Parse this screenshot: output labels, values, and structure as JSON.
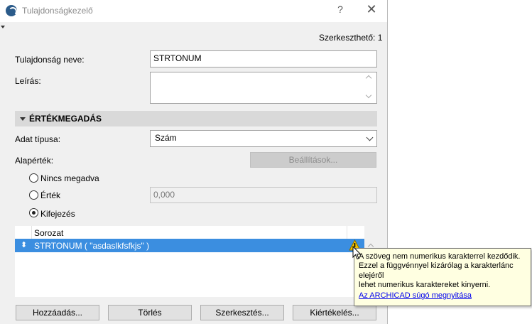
{
  "titlebar": {
    "title": "Tulajdonságkezelő",
    "help": "?",
    "close": "✕"
  },
  "header": {
    "editable": "Szerkeszthető: 1"
  },
  "form": {
    "name_label": "Tulajdonság neve:",
    "name_value": "STRTONUM",
    "description_label": "Leírás:",
    "description_value": ""
  },
  "section": {
    "title": "ÉRTÉKMEGADÁS"
  },
  "value_definition": {
    "data_type_label": "Adat típusa:",
    "data_type_value": "Szám",
    "default_label": "Alapérték:",
    "settings_button": "Beállítások...",
    "options": [
      {
        "label": "Nincs megadva",
        "checked": false
      },
      {
        "label": "Érték",
        "checked": false
      },
      {
        "label": "Kifejezés",
        "checked": true
      }
    ],
    "value_placeholder": "0,000"
  },
  "expression_list": {
    "column_header": "Sorozat",
    "rows": [
      {
        "text": "STRTONUM ( \"asdaslkfsfkjs\" )",
        "selected": true
      }
    ]
  },
  "tooltip": {
    "line1": "A szöveg nem numerikus karakterrel kezdődik.",
    "line2": "Ezzel a függvénnyel kizárólag a karakterlánc",
    "line3": "elejéről",
    "line4": "lehet numerikus karaktereket kinyerni.",
    "link": "Az ARCHICAD súgó megnyitása"
  },
  "buttons": {
    "add": "Hozzáadás...",
    "delete": "Törlés",
    "edit": "Szerkesztés...",
    "evaluate": "Kiértékelés..."
  },
  "colors": {
    "selection": "#3b8ee0",
    "warning": "#f5c400",
    "tooltip_bg": "#ffffe1"
  }
}
